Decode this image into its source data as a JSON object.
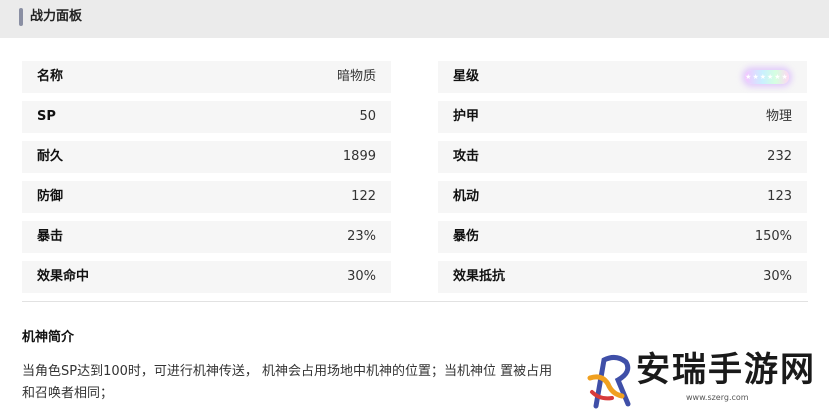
{
  "header": {
    "title": "战力面板"
  },
  "stats": {
    "left": [
      {
        "label": "名称",
        "value": "暗物质"
      },
      {
        "label": "SP",
        "value": "50"
      },
      {
        "label": "耐久",
        "value": "1899"
      },
      {
        "label": "防御",
        "value": "122"
      },
      {
        "label": "暴击",
        "value": "23%"
      },
      {
        "label": "效果命中",
        "value": "30%"
      }
    ],
    "right": [
      {
        "label": "星级",
        "value": "★★★★★★"
      },
      {
        "label": "护甲",
        "value": "物理"
      },
      {
        "label": "攻击",
        "value": "232"
      },
      {
        "label": "机动",
        "value": "123"
      },
      {
        "label": "暴伤",
        "value": "150%"
      },
      {
        "label": "效果抵抗",
        "value": "30%"
      }
    ]
  },
  "intro": {
    "title": "机神简介",
    "line1": "当角色SP达到100时，可进行机神传送， 机神会占用场地中机神的位置；当机神位 置被占用",
    "line2": "和召唤者相同；"
  },
  "watermark": {
    "title": "安瑞手游网",
    "url": "www.szerg.com"
  }
}
